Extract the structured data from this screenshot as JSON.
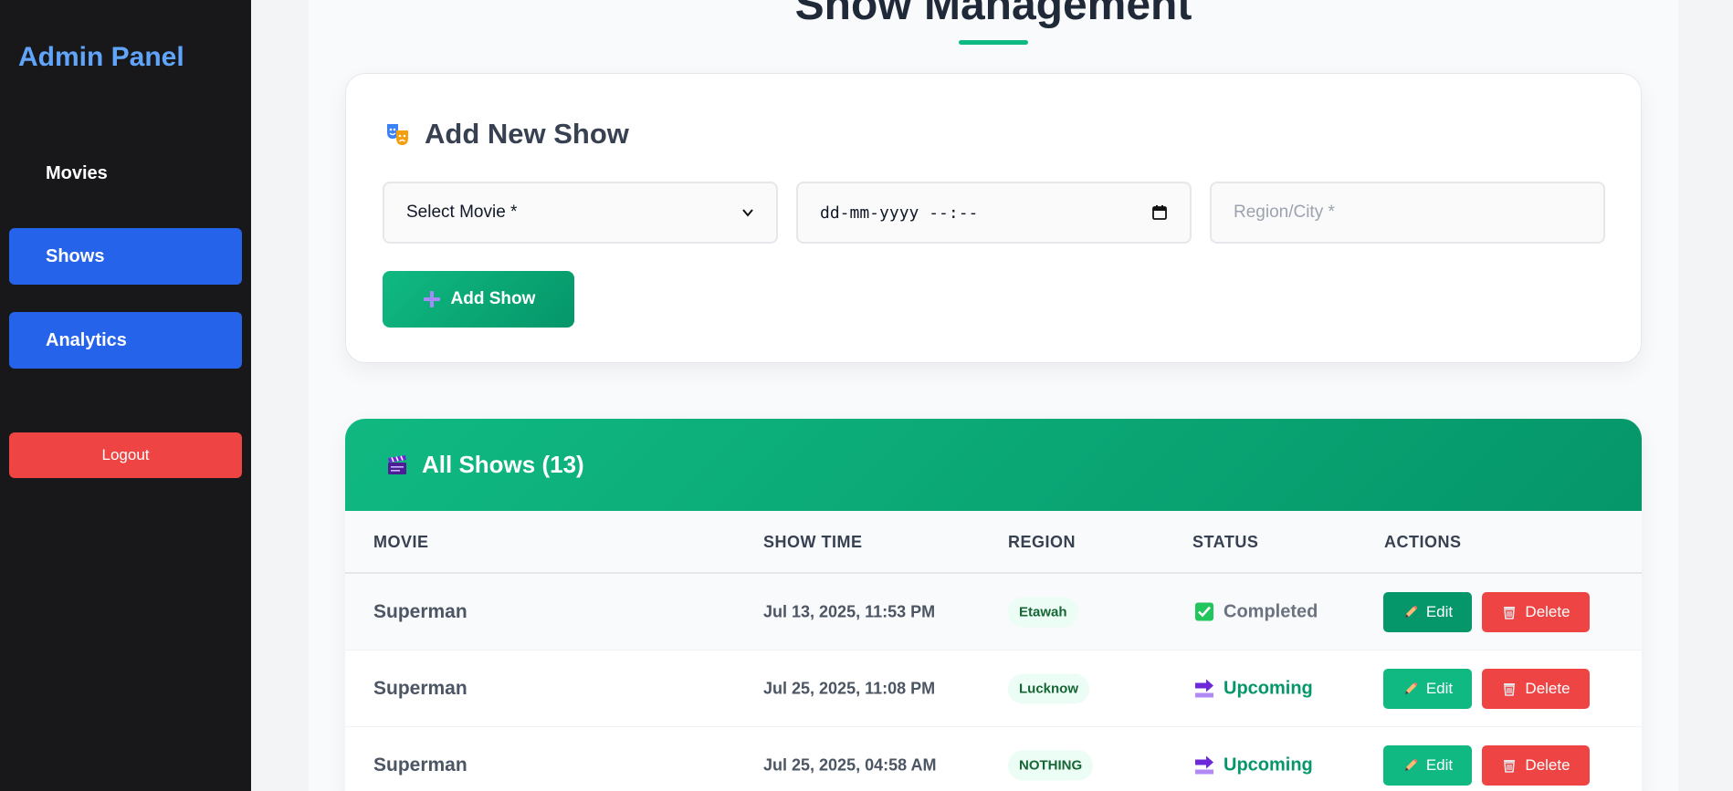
{
  "sidebar": {
    "brand": "Admin Panel",
    "items": [
      {
        "label": "Movies"
      },
      {
        "label": "Shows"
      },
      {
        "label": "Analytics"
      }
    ],
    "logout_label": "Logout"
  },
  "page": {
    "title": "Show Management"
  },
  "add_form": {
    "title": "Add New Show",
    "movie_select_value": "Select Movie *",
    "datetime_placeholder": "dd-mm-yyyy --:--",
    "region_placeholder": "Region/City *",
    "submit_label": "Add Show"
  },
  "shows_table": {
    "title": "All Shows (13)",
    "columns": [
      "MOVIE",
      "SHOW TIME",
      "REGION",
      "STATUS",
      "ACTIONS"
    ],
    "rows": [
      {
        "movie": "Superman",
        "time": "Jul 13, 2025, 11:53 PM",
        "region": "Etawah",
        "status": "Completed",
        "status_icon": "check-box-icon"
      },
      {
        "movie": "Superman",
        "time": "Jul 25, 2025, 11:08 PM",
        "region": "Lucknow",
        "status": "Upcoming",
        "status_icon": "soon-arrow-icon"
      },
      {
        "movie": "Superman",
        "time": "Jul 25, 2025, 04:58 AM",
        "region": "NOTHING",
        "status": "Upcoming",
        "status_icon": "soon-arrow-icon"
      }
    ],
    "edit_label": "Edit",
    "delete_label": "Delete"
  },
  "colors": {
    "sidebar_bg": "#18181b",
    "brand": "#60a5fa",
    "nav_active": "#2563eb",
    "logout": "#ef4444",
    "accent_green": "#10b981",
    "delete_red": "#ef4444"
  }
}
